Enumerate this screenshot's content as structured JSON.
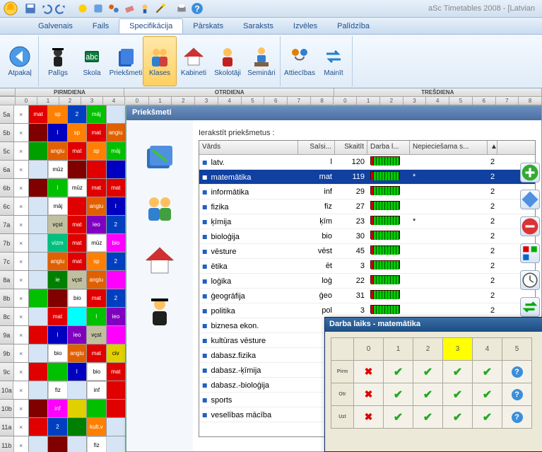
{
  "app_title": "aSc Timetables 2008 - [Latvian",
  "menu": [
    "Galvenais",
    "Fails",
    "Specifikācija",
    "Pārskats",
    "Saraksts",
    "Izvēles",
    "Palīdzība"
  ],
  "menu_active": 2,
  "ribbon": {
    "back": "Atpakaļ",
    "items": [
      "Palīgs",
      "Skola",
      "Priekšmeti",
      "Klases",
      "Kabineti",
      "Skolotāji",
      "Semināri"
    ],
    "active": 3,
    "group2": [
      "Attiecības",
      "Mainīt"
    ]
  },
  "days": [
    "PIRMDIENA",
    "OTRDIENA",
    "TREŠDIENA"
  ],
  "periods": [
    "0",
    "1",
    "2",
    "3",
    "4",
    "5",
    "6",
    "7",
    "8"
  ],
  "tt_rows": [
    {
      "h": "5a",
      "cells": [
        {
          "t": "mat",
          "c": "#e00000"
        },
        {
          "t": "sp",
          "c": "#ff8000"
        },
        {
          "t": "2",
          "c": "#0040c0"
        },
        {
          "t": "māj",
          "c": "#00c000"
        }
      ]
    },
    {
      "h": "5b",
      "cells": [
        {
          "t": "",
          "c": "#800000"
        },
        {
          "t": "l",
          "c": "#0000c0"
        },
        {
          "t": "sp",
          "c": "#ff8000"
        },
        {
          "t": "mat",
          "c": "#e00000"
        },
        {
          "t": "angiu",
          "c": "#e06000"
        }
      ]
    },
    {
      "h": "5c",
      "cells": [
        {
          "t": "",
          "c": "#00a000"
        },
        {
          "t": "angiu",
          "c": "#e06000"
        },
        {
          "t": "mat",
          "c": "#e00000"
        },
        {
          "t": "sp",
          "c": "#ff8000"
        },
        {
          "t": "māj",
          "c": "#00c000"
        }
      ]
    },
    {
      "h": "6a",
      "cells": [
        {
          "t": "",
          "c": ""
        },
        {
          "t": "mūz",
          "c": "#ffffff"
        },
        {
          "t": "",
          "c": "#800000"
        },
        {
          "t": "",
          "c": "#e00000"
        },
        {
          "t": "",
          "c": "#0000c0"
        }
      ]
    },
    {
      "h": "6b",
      "cells": [
        {
          "t": "",
          "c": "#800000"
        },
        {
          "t": "l",
          "c": "#00c000"
        },
        {
          "t": "mūz",
          "c": "#ffffff"
        },
        {
          "t": "mat",
          "c": "#e00000"
        },
        {
          "t": "mat",
          "c": "#e00000"
        }
      ]
    },
    {
      "h": "6c",
      "cells": [
        {
          "t": "",
          "c": ""
        },
        {
          "t": "māj",
          "c": "#ffffff"
        },
        {
          "t": "",
          "c": "#e00000"
        },
        {
          "t": "angiu",
          "c": "#e06000"
        },
        {
          "t": "l",
          "c": "#0000c0"
        }
      ]
    },
    {
      "h": "7a",
      "cells": [
        {
          "t": "",
          "c": ""
        },
        {
          "t": "vçst",
          "c": "#c0c0a0"
        },
        {
          "t": "mat",
          "c": "#e00000"
        },
        {
          "t": "ìeo",
          "c": "#8000c0"
        },
        {
          "t": "2",
          "c": "#0040c0"
        }
      ]
    },
    {
      "h": "7b",
      "cells": [
        {
          "t": "",
          "c": ""
        },
        {
          "t": "vizm",
          "c": "#00c080"
        },
        {
          "t": "mat",
          "c": "#e00000"
        },
        {
          "t": "mūz",
          "c": "#ffffff"
        },
        {
          "t": "bio",
          "c": "#ff00ff"
        }
      ]
    },
    {
      "h": "7c",
      "cells": [
        {
          "t": "",
          "c": ""
        },
        {
          "t": "angiu",
          "c": "#e06000"
        },
        {
          "t": "mat",
          "c": "#e00000"
        },
        {
          "t": "sp",
          "c": "#ff8000"
        },
        {
          "t": "2",
          "c": "#0040c0"
        }
      ]
    },
    {
      "h": "8a",
      "cells": [
        {
          "t": "",
          "c": ""
        },
        {
          "t": "ie",
          "c": "#008000"
        },
        {
          "t": "vçst",
          "c": "#c0c0a0"
        },
        {
          "t": "angiu",
          "c": "#e06000"
        },
        {
          "t": "",
          "c": "#ff00ff"
        }
      ]
    },
    {
      "h": "8b",
      "cells": [
        {
          "t": "",
          "c": "#00c000"
        },
        {
          "t": "",
          "c": "#800000"
        },
        {
          "t": "bio",
          "c": "#ffffff"
        },
        {
          "t": "mat",
          "c": "#e00000"
        },
        {
          "t": "2",
          "c": "#0040c0"
        }
      ]
    },
    {
      "h": "8c",
      "cells": [
        {
          "t": "",
          "c": ""
        },
        {
          "t": "mat",
          "c": "#e00000"
        },
        {
          "t": "",
          "c": "#00ffff"
        },
        {
          "t": "l",
          "c": "#00c000"
        },
        {
          "t": "ìeo",
          "c": "#8000c0"
        }
      ]
    },
    {
      "h": "9a",
      "cells": [
        {
          "t": "",
          "c": "#e00000"
        },
        {
          "t": "l",
          "c": "#0000c0"
        },
        {
          "t": "ìeo",
          "c": "#8000c0"
        },
        {
          "t": "vçst",
          "c": "#c0c0a0"
        },
        {
          "t": "",
          "c": "#ff00ff"
        }
      ]
    },
    {
      "h": "9b",
      "cells": [
        {
          "t": "",
          "c": ""
        },
        {
          "t": "bio",
          "c": "#ffffff"
        },
        {
          "t": "angiu",
          "c": "#e06000"
        },
        {
          "t": "mat",
          "c": "#e00000"
        },
        {
          "t": "civ",
          "c": "#e0d000"
        }
      ]
    },
    {
      "h": "9c",
      "cells": [
        {
          "t": "",
          "c": "#e00000"
        },
        {
          "t": "",
          "c": "#00c000"
        },
        {
          "t": "l",
          "c": "#0000c0"
        },
        {
          "t": "bio",
          "c": "#ffffff"
        },
        {
          "t": "mat",
          "c": "#e00000"
        }
      ]
    },
    {
      "h": "10a",
      "cells": [
        {
          "t": "",
          "c": ""
        },
        {
          "t": "fiz",
          "c": "#ffffff"
        },
        {
          "t": "",
          "c": ""
        },
        {
          "t": "inf",
          "c": "#ffffff"
        },
        {
          "t": "",
          "c": "#e00000"
        }
      ]
    },
    {
      "h": "10b",
      "cells": [
        {
          "t": "",
          "c": "#800000"
        },
        {
          "t": "inf",
          "c": "#ff00ff"
        },
        {
          "t": "",
          "c": "#e0d000"
        },
        {
          "t": "",
          "c": "#00c000"
        },
        {
          "t": "",
          "c": "#e00000"
        }
      ]
    },
    {
      "h": "11a",
      "cells": [
        {
          "t": "",
          "c": "#e00000"
        },
        {
          "t": "2",
          "c": "#0040c0"
        },
        {
          "t": "",
          "c": "#008000"
        },
        {
          "t": "kult.v",
          "c": "#ff8000"
        },
        {
          "t": "",
          "c": ""
        }
      ]
    },
    {
      "h": "11b",
      "cells": [
        {
          "t": "",
          "c": ""
        },
        {
          "t": "",
          "c": "#800000"
        },
        {
          "t": "",
          "c": ""
        },
        {
          "t": "fiz",
          "c": "#ffffff"
        },
        {
          "t": "",
          "c": ""
        }
      ]
    }
  ],
  "panel": {
    "title": "Priekšmeti",
    "label": "Ierakstīt priekšmetus :",
    "cols": {
      "name": "Vārds",
      "sais": "Saīsi...",
      "count": "Skaitīt",
      "darba": "Darba l...",
      "nep": "Nepieciešama s..."
    },
    "subjects": [
      {
        "name": "latv.",
        "abbr": "l",
        "count": 120,
        "nep": ""
      },
      {
        "name": "matemātika",
        "abbr": "mat",
        "count": 119,
        "nep": "*",
        "selected": true
      },
      {
        "name": "informātika",
        "abbr": "inf",
        "count": 29,
        "nep": ""
      },
      {
        "name": "fizika",
        "abbr": "fiz",
        "count": 27,
        "nep": ""
      },
      {
        "name": "ķīmija",
        "abbr": "ķīm",
        "count": 23,
        "nep": "*"
      },
      {
        "name": "bioloģija",
        "abbr": "bio",
        "count": 30,
        "nep": ""
      },
      {
        "name": "vēsture",
        "abbr": "vēst",
        "count": 45,
        "nep": ""
      },
      {
        "name": "ētika",
        "abbr": "ēt",
        "count": 3,
        "nep": ""
      },
      {
        "name": "loģika",
        "abbr": "loģ",
        "count": 22,
        "nep": ""
      },
      {
        "name": "ģeogrāfija",
        "abbr": "ģeo",
        "count": 31,
        "nep": ""
      },
      {
        "name": "politika",
        "abbr": "pol",
        "count": 3,
        "nep": ""
      },
      {
        "name": "biznesa ekon.",
        "abbr": "",
        "count": "",
        "nep": ""
      },
      {
        "name": "kultūras vēsture",
        "abbr": "",
        "count": "",
        "nep": ""
      },
      {
        "name": "dabasz.fizika",
        "abbr": "",
        "count": "",
        "nep": ""
      },
      {
        "name": "dabasz.-ķīmija",
        "abbr": "",
        "count": "",
        "nep": ""
      },
      {
        "name": "dabasz.-bioloģija",
        "abbr": "",
        "count": "",
        "nep": ""
      },
      {
        "name": "sports",
        "abbr": "",
        "count": "",
        "nep": ""
      },
      {
        "name": "veselības mācība",
        "abbr": "",
        "count": "",
        "nep": ""
      }
    ]
  },
  "popup": {
    "title": "Darba laiks - matemātika",
    "cols": [
      "0",
      "1",
      "2",
      "3",
      "4",
      "5"
    ],
    "rows": [
      "Pirm",
      "Otr",
      "Uzī"
    ]
  }
}
